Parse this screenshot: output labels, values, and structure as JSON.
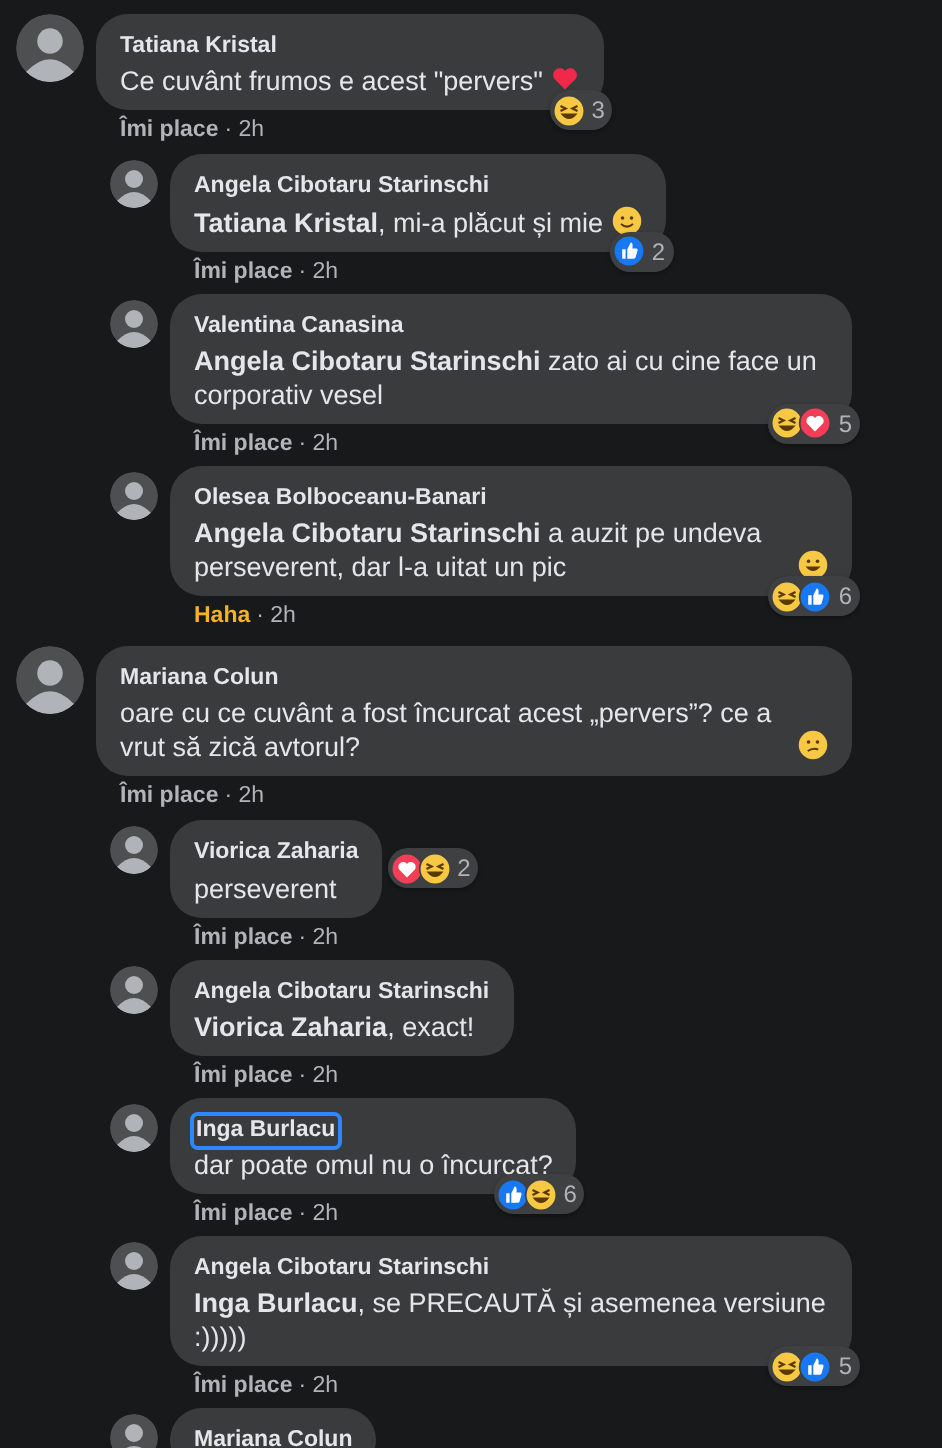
{
  "comments": [
    {
      "author": "Tatiana Kristal",
      "text": "Ce cuvânt frumos e acest \"pervers\"",
      "emoji": {
        "kind": "heart"
      },
      "reactions": [
        {
          "kind": "haha"
        }
      ],
      "reaction_count": "3",
      "action": {
        "label": "Îmi place",
        "kind": "like"
      },
      "time": "· 2h",
      "children": [
        {
          "author": "Angela Cibotaru Starinschi",
          "text": "**Tatiana Kristal**, mi-a plăcut și mie",
          "emoji": {
            "kind": "smile"
          },
          "reactions": [
            {
              "kind": "like"
            }
          ],
          "reaction_count": "2",
          "action": {
            "label": "Îmi place",
            "kind": "like"
          },
          "time": "· 2h"
        },
        {
          "author": "Valentina Canasina",
          "text": "**Angela Cibotaru Starinschi** zato ai cu cine face un corporativ vesel",
          "reactions": [
            {
              "kind": "haha"
            },
            {
              "kind": "love"
            }
          ],
          "reaction_count": "5",
          "action": {
            "label": "Îmi place",
            "kind": "like"
          },
          "time": "· 2h"
        },
        {
          "author": "Olesea Bolboceanu-Banari",
          "text": "**Angela Cibotaru Starinschi** a auzit pe undeva perseverent, dar l-a uitat un pic",
          "emoji": {
            "kind": "grin"
          },
          "reactions": [
            {
              "kind": "haha"
            },
            {
              "kind": "like"
            }
          ],
          "reaction_count": "6",
          "action": {
            "label": "Haha",
            "kind": "haha"
          },
          "time": "· 2h"
        }
      ]
    },
    {
      "author": "Mariana Colun",
      "text": "oare cu ce cuvânt a fost încurcat acest „pervers”? ce a vrut să zică avtorul?",
      "emoji": {
        "kind": "confused"
      },
      "action": {
        "label": "Îmi place",
        "kind": "like"
      },
      "time": "· 2h",
      "children": [
        {
          "author": "Viorica Zaharia",
          "text": "perseverent",
          "reactions": [
            {
              "kind": "love"
            },
            {
              "kind": "haha"
            }
          ],
          "reaction_count": "2",
          "action": {
            "label": "Îmi place",
            "kind": "like"
          },
          "time": "· 2h"
        },
        {
          "author": "Angela Cibotaru Starinschi",
          "text": "**Viorica Zaharia**, exact!",
          "action": {
            "label": "Îmi place",
            "kind": "like"
          },
          "time": "· 2h"
        },
        {
          "author": "Inga Burlacu",
          "focused": true,
          "text": "dar poate omul nu o încurcat?",
          "reactions": [
            {
              "kind": "like"
            },
            {
              "kind": "haha"
            }
          ],
          "reaction_count": "6",
          "action": {
            "label": "Îmi place",
            "kind": "like"
          },
          "time": "· 2h"
        },
        {
          "author": "Angela Cibotaru Starinschi",
          "text": "**Inga Burlacu**, se PRECAUTĂ și asemenea versiune :)))))",
          "reactions": [
            {
              "kind": "haha"
            },
            {
              "kind": "like"
            }
          ],
          "reaction_count": "5",
          "action": {
            "label": "Îmi place",
            "kind": "like"
          },
          "time": "· 2h"
        },
        {
          "author": "Mariana Colun"
        }
      ]
    }
  ]
}
